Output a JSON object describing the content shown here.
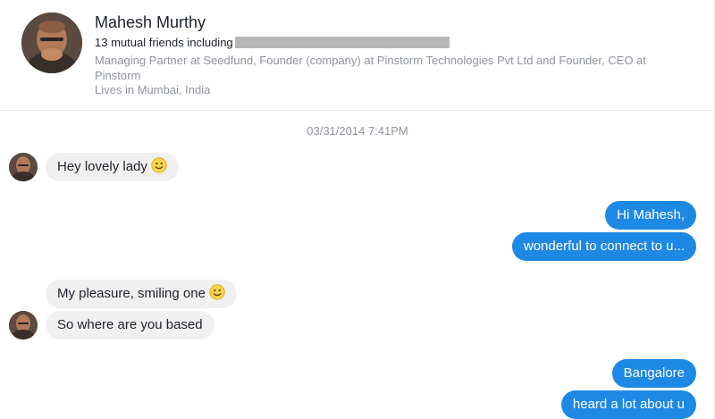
{
  "profile": {
    "name": "Mahesh Murthy",
    "mutual_friends": "13 mutual friends including",
    "work": "Managing Partner at Seedfund, Founder (company) at Pinstorm Technologies Pvt Ltd and Founder, CEO at Pinstorm",
    "location": "Lives in Mumbai, India"
  },
  "conversation": {
    "timestamp": "03/31/2014 7:41PM",
    "messages": [
      {
        "direction": "in",
        "text": "Hey lovely lady",
        "emoji": "smile-emoji"
      },
      {
        "direction": "out",
        "text": "Hi Mahesh,"
      },
      {
        "direction": "out",
        "text": "wonderful to connect to u..."
      },
      {
        "direction": "in",
        "text": "My pleasure, smiling one",
        "emoji": "smile-emoji"
      },
      {
        "direction": "in",
        "text": "So where are you based"
      },
      {
        "direction": "out",
        "text": "Bangalore"
      },
      {
        "direction": "out",
        "text": "heard a lot about u"
      }
    ]
  },
  "colors": {
    "outgoing_bubble": "#1e88e5",
    "incoming_bubble": "#f1f0f0",
    "muted_text": "#90949c",
    "redaction": "#b7b7b7"
  }
}
